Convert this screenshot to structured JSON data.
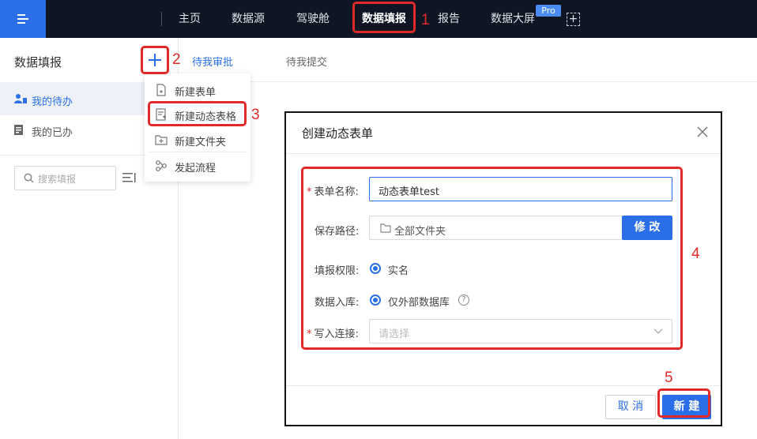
{
  "topnav": {
    "items": [
      {
        "label": "主页"
      },
      {
        "label": "数据源"
      },
      {
        "label": "驾驶舱"
      },
      {
        "label": "数据填报"
      },
      {
        "label": "报告"
      },
      {
        "label": "数据大屏"
      }
    ],
    "active_item": "数据填报",
    "pro_badge": "Pro",
    "add_icon": "plus-square-icon",
    "menu_icon": "menu-collapse-icon"
  },
  "sidebar": {
    "title": "数据填报",
    "add_icon": "plus-icon",
    "items": [
      {
        "label": "我的待办",
        "icon": "user-todo-icon",
        "active": true
      },
      {
        "label": "我的已办",
        "icon": "document-done-icon",
        "active": false
      }
    ],
    "search": {
      "placeholder": "搜索填报",
      "icon": "search-icon"
    },
    "sort_icon": "sort-icon"
  },
  "dropdown": {
    "items": [
      {
        "label": "新建表单",
        "icon": "new-form-icon"
      },
      {
        "label": "新建动态表格",
        "icon": "new-dynamic-table-icon"
      },
      {
        "label": "新建文件夹",
        "icon": "new-folder-icon"
      },
      {
        "label": "发起流程",
        "icon": "start-process-icon"
      }
    ]
  },
  "tabs": [
    {
      "label": "待我审批",
      "active": true
    },
    {
      "label": "待我提交",
      "active": false
    }
  ],
  "dialog": {
    "title": "创建动态表单",
    "close_icon": "close-icon",
    "fields": {
      "name": {
        "label": "表单名称:",
        "required": "*",
        "value": "动态表单test"
      },
      "path": {
        "label": "保存路径:",
        "value": "全部文件夹",
        "icon": "folder-icon",
        "button": "修 改"
      },
      "permission": {
        "label": "填报权限:",
        "option": "实名"
      },
      "storage": {
        "label": "数据入库:",
        "option": "仅外部数据库",
        "help_icon": "?"
      },
      "connection": {
        "label": "写入连接:",
        "required": "*",
        "placeholder": "请选择",
        "icon": "chevron-down-icon"
      }
    },
    "cancel_label": "取 消",
    "create_label": "新 建"
  },
  "annotations": {
    "step1": "1",
    "step2": "2",
    "step3": "3",
    "step4": "4",
    "step5": "5",
    "color": "#e02a2a"
  },
  "colors": {
    "accent": "#2b6fe8",
    "topbar": "#0f1523"
  }
}
